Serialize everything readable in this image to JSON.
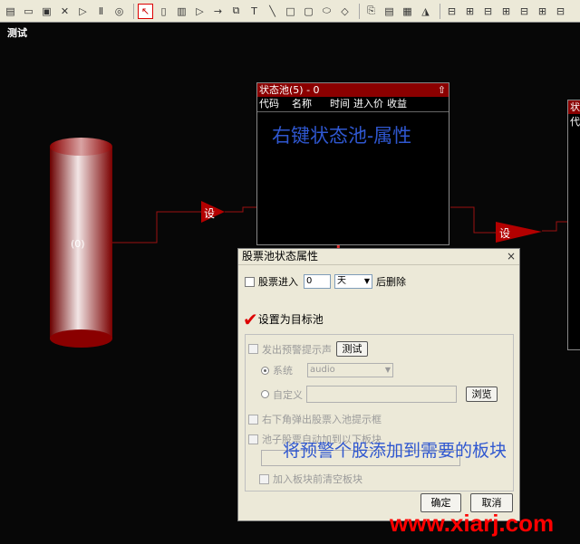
{
  "toolbar": {
    "items": [
      "new-doc-icon",
      "open-folder-icon",
      "save-icon",
      "delete-icon",
      "play-icon",
      "pause-icon",
      "stop-icon",
      "pointer-icon",
      "cylinder-icon",
      "pool-icon",
      "triangle-icon",
      "arrow-icon",
      "multi-icon",
      "text-icon",
      "line-icon",
      "rect-icon",
      "round-rect-icon",
      "ellipse-icon",
      "diamond-icon",
      "copy-icon",
      "paste-icon",
      "trash-icon",
      "paint-icon",
      "align-icon",
      "align2-icon",
      "align3-icon",
      "align4-icon",
      "align5-icon",
      "align6-icon",
      "align7-icon"
    ]
  },
  "canvas": {
    "title": "测试",
    "cylinder_label": "(0)",
    "set_label_1": "设",
    "set_label_2": "设"
  },
  "pool": {
    "title": "状态池(5) - 0",
    "columns": [
      "代码",
      "名称",
      "时间",
      "进入价",
      "收益"
    ]
  },
  "pool2": {
    "title": "状",
    "column": "代"
  },
  "annotation_top": "右键状态池-属性",
  "annotation_bottom": "将预警个股添加到需要的板块",
  "dialog": {
    "title": "股票池状态属性",
    "close": "×",
    "stock_enter_label": "股票进入",
    "days_value": "0",
    "days_unit": "天",
    "after_delete": "后删除",
    "target_pool": "设置为目标池",
    "alert_sound": "发出预警提示声",
    "test_button": "测试",
    "system_label": "系统",
    "audio_value": "audio",
    "custom_label": "自定义",
    "browse_button": "浏览",
    "popup_label": "右下角弹出股票入池提示框",
    "auto_add_label": "池子股票自动加到以下板块",
    "clear_block_label": "加入板块前清空板块",
    "ok_button": "确定",
    "cancel_button": "取消"
  },
  "watermark": "www.xiarj.com",
  "colors": {
    "accent_red": "#cc0000",
    "annotation_blue": "#2f57d0",
    "pool_title": "#8b0000"
  }
}
